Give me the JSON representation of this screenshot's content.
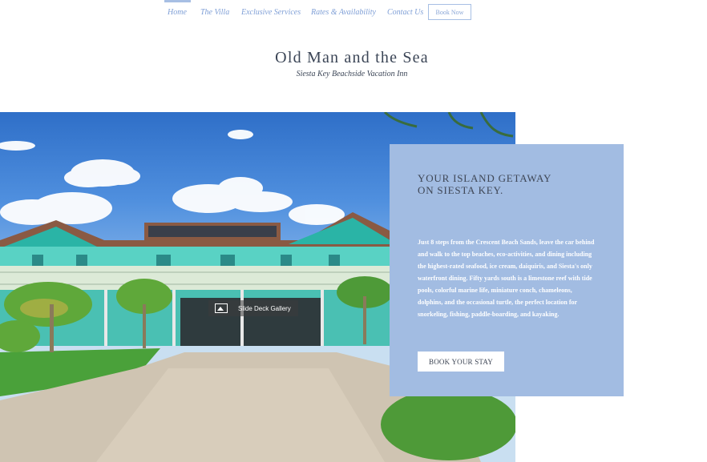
{
  "nav": {
    "items": [
      {
        "label": "Home",
        "active": true
      },
      {
        "label": "The Villa",
        "active": false
      },
      {
        "label": "Exclusive Services",
        "active": false
      },
      {
        "label": "Rates & Availability",
        "active": false
      },
      {
        "label": "Contact Us",
        "active": false
      }
    ],
    "book_label": "Book Now"
  },
  "header": {
    "title": "Old Man and the Sea",
    "subtitle": "Siesta Key Beachside Vacation Inn"
  },
  "hero": {
    "gallery_label": "Slide Deck Gallery",
    "gallery_icon": "image-icon"
  },
  "panel": {
    "heading_line1": "YOUR ISLAND GETAWAY",
    "heading_line2": "ON SIESTA KEY.",
    "body": "Just 8 steps from the Crescent Beach Sands, leave the car behind and walk to the top beaches, eco-activities, and dining including the highest-rated seafood, ice cream, daiquiris, and Siesta's only waterfront dining.  Fifty yards south is a limestone reef with tide pools, colorful marine life, miniature conch, chameleons,  dolphins, and the occasional turtle, the perfect location for snorkeling, fishing, paddle-boarding, and kayaking.",
    "button_label": "BOOK YOUR STAY"
  },
  "colors": {
    "accent": "#a2bce2",
    "nav_text": "#7f9fd6",
    "title_text": "#3b4556"
  }
}
